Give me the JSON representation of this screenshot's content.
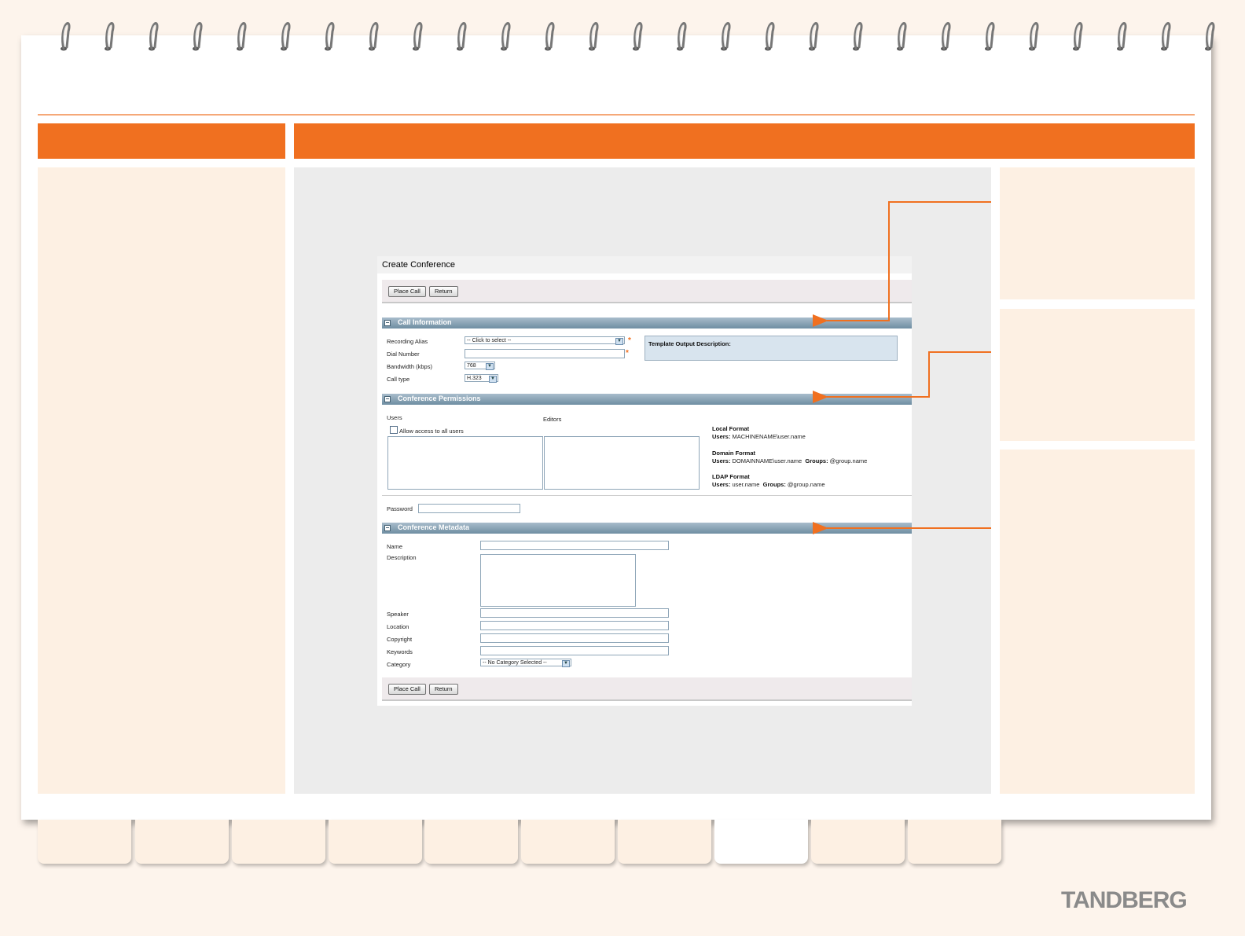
{
  "screenshot": {
    "title": "Create Conference",
    "toolbar": {
      "place_call": "Place Call",
      "return": "Return"
    },
    "sections": {
      "call_information": "Call Information",
      "conference_permissions": "Conference Permissions",
      "conference_metadata": "Conference Metadata"
    },
    "call_info": {
      "recording_alias_label": "Recording Alias",
      "recording_alias_value": "-- Click to select --",
      "dial_number_label": "Dial Number",
      "bandwidth_label": "Bandwidth (kbps)",
      "bandwidth_value": "768",
      "call_type_label": "Call type",
      "call_type_value": "H.323",
      "template_output_label": "Template Output Description:"
    },
    "permissions": {
      "users_label": "Users",
      "editors_label": "Editors",
      "allow_all_label": "Allow access to all users",
      "local_format_title": "Local Format",
      "local_format_users_key": "Users:",
      "local_format_users_value": "MACHINENAME\\user.name",
      "domain_format_title": "Domain Format",
      "domain_format_users_key": "Users:",
      "domain_format_users_value": "DOMAINNAME\\user.name",
      "domain_format_groups_key": "Groups:",
      "domain_format_groups_value": "@group.name",
      "ldap_format_title": "LDAP Format",
      "ldap_format_users_key": "Users:",
      "ldap_format_users_value": "user.name",
      "ldap_format_groups_key": "Groups:",
      "ldap_format_groups_value": "@group.name",
      "password_label": "Password"
    },
    "metadata": {
      "name_label": "Name",
      "description_label": "Description",
      "speaker_label": "Speaker",
      "location_label": "Location",
      "copyright_label": "Copyright",
      "keywords_label": "Keywords",
      "category_label": "Category",
      "category_value": "-- No Category Selected --"
    }
  },
  "icons": {
    "dropdown": "chevron-down-icon",
    "collapse": "collapse-square-icon",
    "required": "asterisk-icon"
  },
  "colors": {
    "accent": "#f07020",
    "panel": "#fdf0e3",
    "section_header": "#6f8ea2"
  },
  "brand": {
    "logo": "TANDBERG"
  }
}
